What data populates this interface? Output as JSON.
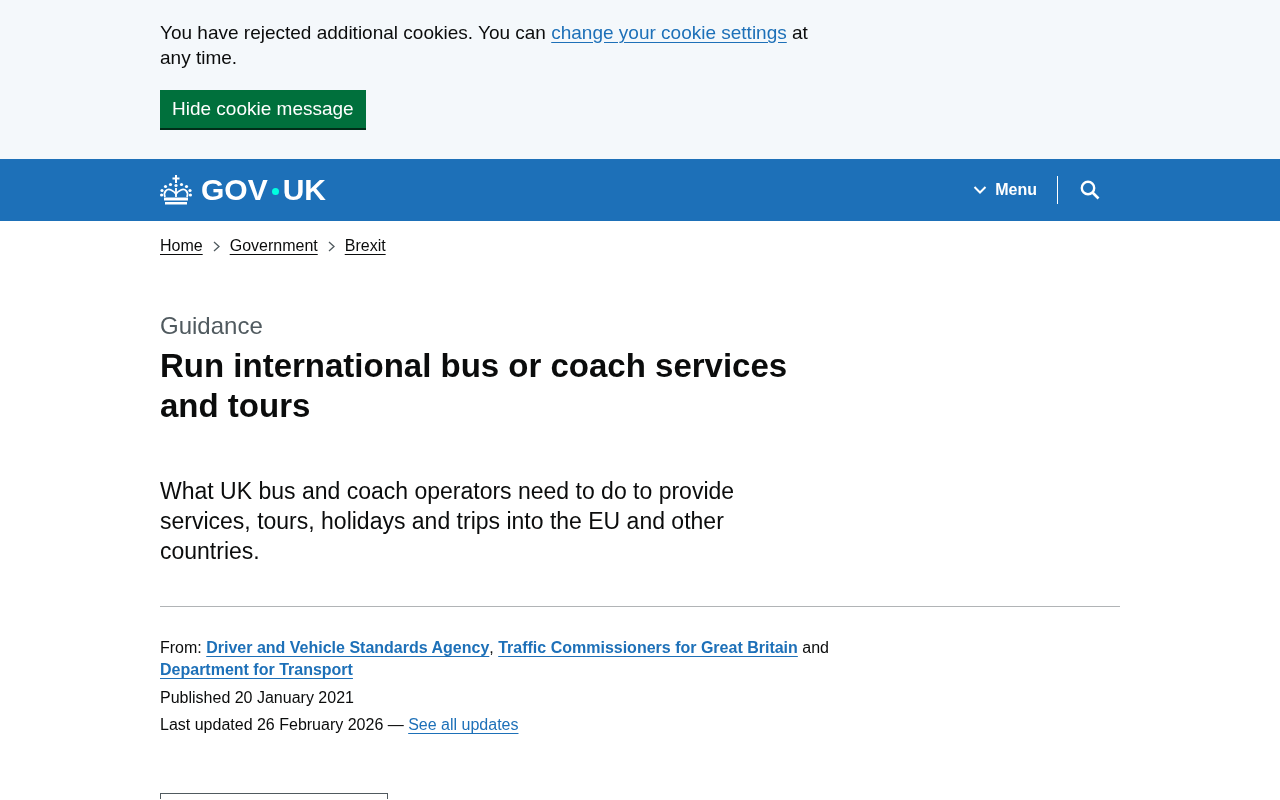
{
  "cookie_banner": {
    "message": [
      {
        "kind": "text",
        "text": "You have rejected additional cookies. You can "
      },
      {
        "kind": "link",
        "text": "change your cookie settings"
      },
      {
        "kind": "text",
        "text": " at any time."
      }
    ],
    "button": "Hide cookie message"
  },
  "header": {
    "logo": [
      "GOV",
      "UK"
    ],
    "menu": {
      "label": "Menu",
      "expanded": false
    }
  },
  "breadcrumbs": [
    "Home",
    "Government",
    "Brexit"
  ],
  "caption": "Guidance",
  "title": "Run international bus or coach services and tours",
  "description": "What UK bus and coach operators need to do to provide services, tours, holidays and trips into the EU and other countries.",
  "metadata": {
    "from": {
      "label": "From:",
      "parts": [
        {
          "kind": "link",
          "text": "Driver and Vehicle Standards Agency"
        },
        {
          "kind": "text",
          "text": ", "
        },
        {
          "kind": "link",
          "text": "Traffic Commissioners for Great Britain"
        },
        {
          "kind": "text",
          "text": " and "
        },
        {
          "kind": "link",
          "text": "Department for Transport"
        }
      ]
    },
    "published": {
      "label": "Published",
      "value": "20 January 2021"
    },
    "last_updated": {
      "label": "Last updated",
      "value": "26 February 2026",
      "separator": "—",
      "link": "See all updates"
    }
  }
}
